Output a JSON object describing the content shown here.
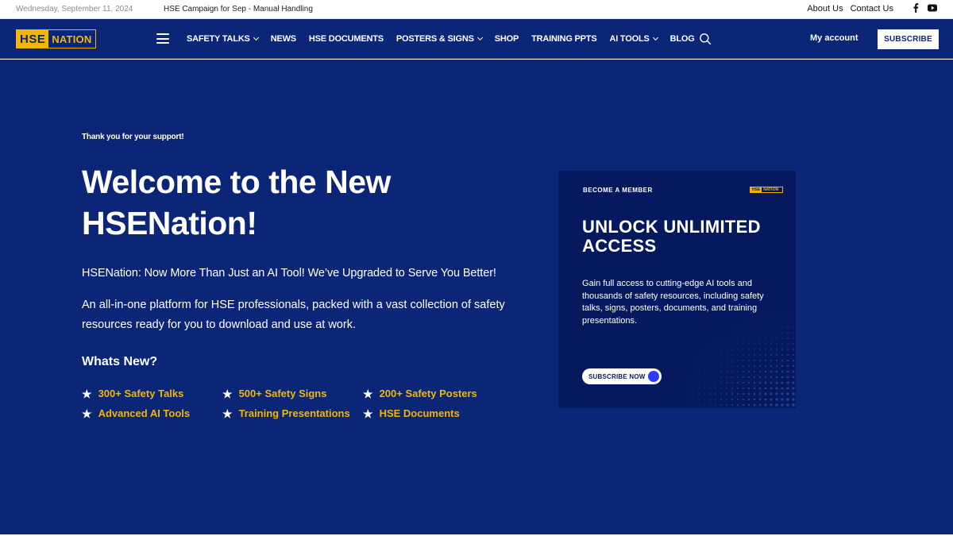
{
  "topbar": {
    "date": "Wednesday, September 11, 2024",
    "ticker": "HSE Campaign for Sep - Manual Handling",
    "links": [
      "About Us",
      "Contact Us"
    ],
    "social": [
      "facebook-icon",
      "youtube-icon"
    ]
  },
  "header": {
    "logo_part1": "HSE",
    "logo_part2": "NATION",
    "nav": [
      {
        "label": "SAFETY TALKS",
        "dropdown": true
      },
      {
        "label": "NEWS",
        "dropdown": false
      },
      {
        "label": "HSE DOCUMENTS",
        "dropdown": false
      },
      {
        "label": "POSTERS & SIGNS",
        "dropdown": true
      },
      {
        "label": "SHOP",
        "dropdown": false
      },
      {
        "label": "TRAINING PPTS",
        "dropdown": false
      },
      {
        "label": "AI TOOLS",
        "dropdown": true
      },
      {
        "label": "BLOG",
        "dropdown": false
      }
    ],
    "account": "My account",
    "subscribe": "SUBSCRIBE"
  },
  "hero": {
    "thanks": "Thank you for your support!",
    "title": "Welcome to the New HSENation!",
    "subtitle": "HSENation: Now More Than Just an AI Tool! We’ve Upgraded to Serve You Better!",
    "description": "An all-in-one platform for HSE professionals, packed with a vast collection of safety resources ready for you to download and use at work.",
    "whats_new": "Whats New?",
    "features": [
      "300+ Safety Talks",
      "500+ Safety Signs",
      "200+ Safety Posters",
      "Advanced AI Tools",
      "Training Presentations",
      "HSE Documents"
    ]
  },
  "card": {
    "become": "BECOME A MEMBER",
    "mini_logo_part1": "HSE",
    "mini_logo_part2": "NATION",
    "headline": "UNLOCK UNLIMITED ACCESS",
    "text": "Gain full access to cutting-edge AI tools and thousands of safety resources, including safety talks, signs, posters, documents, and training presentations.",
    "cta": "SUBSCRIBE NOW"
  },
  "colors": {
    "brand_blue": "#0b2577",
    "card_blue": "#07195e",
    "accent_yellow": "#f2b705",
    "cta_dot": "#2a3bff"
  }
}
